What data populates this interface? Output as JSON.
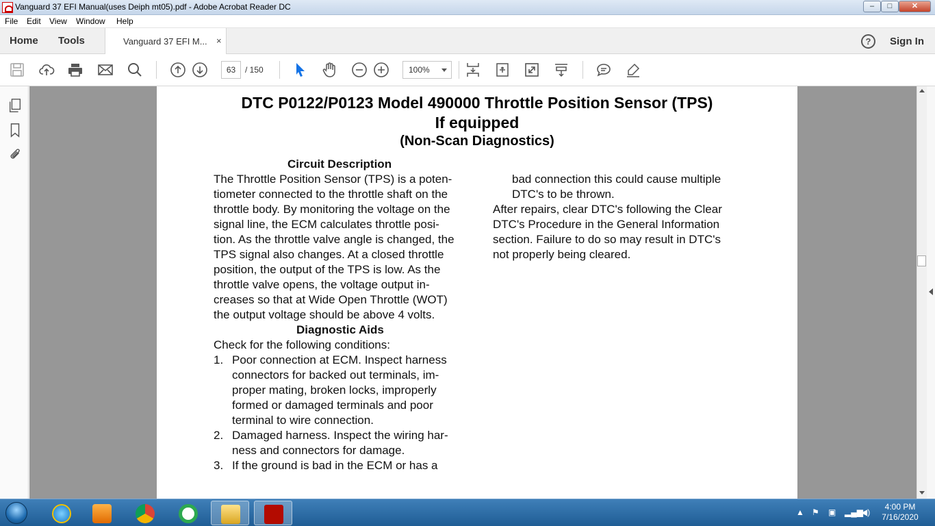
{
  "window": {
    "title": "Vanguard 37 EFI Manual(uses Deiph mt05).pdf - Adobe Acrobat Reader DC",
    "minimize": "–",
    "maximize": "□",
    "close": "✕"
  },
  "menu": [
    "File",
    "Edit",
    "View",
    "Window",
    "Help"
  ],
  "tabs": {
    "home": "Home",
    "tools": "Tools",
    "document": "Vanguard 37 EFI M...",
    "close": "×",
    "help": "?",
    "sign_in": "Sign In"
  },
  "toolbar": {
    "page_current": "63",
    "page_total": "/ 150",
    "zoom": "100%"
  },
  "document": {
    "title_line1": "DTC P0122/P0123 Model 490000 Throttle Position Sensor (TPS)",
    "title_line2": "If equipped",
    "title_line3": "(Non-Scan Diagnostics)",
    "left_column": [
      "Circuit Description",
      "The Throttle Position Sensor (TPS) is a poten-",
      "tiometer connected to the throttle shaft on the",
      "throttle body. By monitoring the voltage on the",
      "signal line, the ECM calculates throttle posi-",
      "tion. As the throttle valve angle is changed, the",
      "TPS signal also changes. At a closed throttle",
      "position, the output of the TPS is low. As the",
      "throttle valve opens, the voltage output in-",
      "creases so that at Wide Open Throttle (WOT)",
      "the output voltage should be above 4 volts.",
      "Diagnostic Aids",
      "Check for the following conditions:"
    ],
    "list_items": [
      {
        "num": "1.",
        "lines": [
          "Poor connection at ECM. Inspect harness",
          "connectors for backed out terminals, im-",
          "proper mating, broken locks, improperly",
          "formed or damaged terminals and poor",
          "terminal to wire connection."
        ]
      },
      {
        "num": "2.",
        "lines": [
          "Damaged harness. Inspect the wiring har-",
          "ness and connectors for damage."
        ]
      },
      {
        "num": "3.",
        "lines": [
          "If the ground is bad in the ECM or has a"
        ]
      }
    ],
    "right_column_cont": [
      "bad connection this could cause multiple",
      "DTC's to be thrown."
    ],
    "right_column": [
      "After repairs, clear DTC's following the Clear",
      "DTC's Procedure in the General Information",
      "section. Failure to do so may result in DTC's",
      "not properly being cleared."
    ]
  },
  "taskbar": {
    "time": "4:00 PM",
    "date": "7/16/2020"
  }
}
